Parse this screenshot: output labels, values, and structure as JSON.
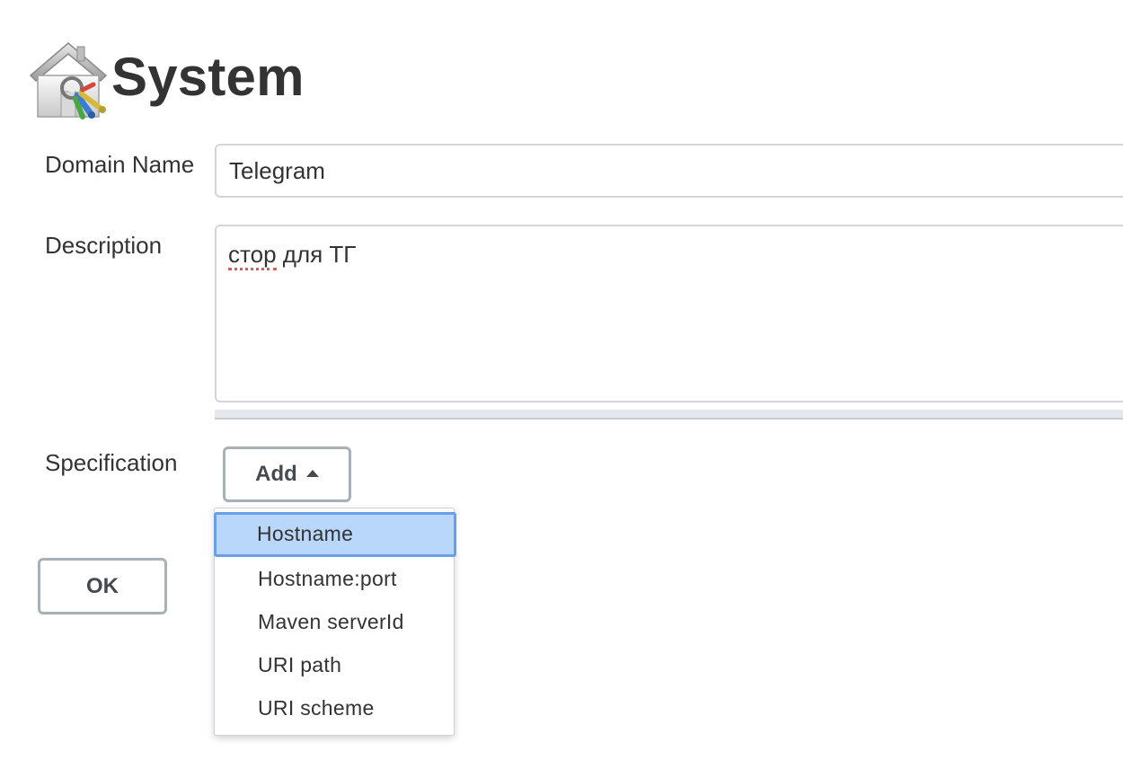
{
  "header": {
    "title": "System",
    "icon": "house-keys-icon"
  },
  "form": {
    "domain_name": {
      "label": "Domain Name",
      "value": "Telegram"
    },
    "description": {
      "label": "Description",
      "value": "стор для ТГ",
      "value_misspelled": "стор",
      "value_rest": " для ТГ"
    },
    "specification": {
      "label": "Specification",
      "add_label": "Add",
      "add_icon": "caret-up-icon"
    },
    "ok_label": "OK"
  },
  "dropdown": {
    "items": [
      {
        "label": "Hostname",
        "selected": true
      },
      {
        "label": "Hostname:port",
        "selected": false
      },
      {
        "label": "Maven serverId",
        "selected": false
      },
      {
        "label": "URI path",
        "selected": false
      },
      {
        "label": "URI scheme",
        "selected": false
      }
    ]
  },
  "colors": {
    "selected_bg": "#b9d6fb",
    "selected_border": "#6a9fe8",
    "button_border": "#a8b0b8",
    "spellcheck": "#e05a5a"
  }
}
